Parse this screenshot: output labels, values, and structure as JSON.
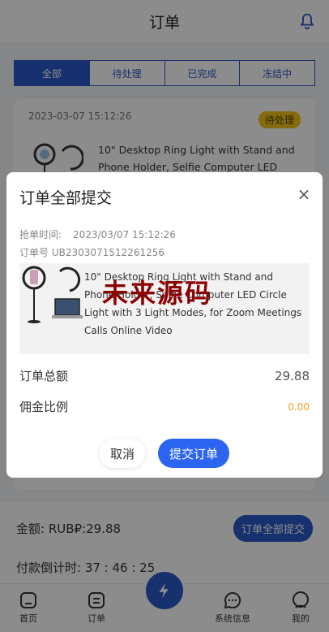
{
  "header": {
    "title": "订单"
  },
  "tabs": [
    {
      "label": "全部",
      "active": true
    },
    {
      "label": "待处理",
      "active": false
    },
    {
      "label": "已完成",
      "active": false
    },
    {
      "label": "冻结中",
      "active": false
    }
  ],
  "order_card": {
    "time": "2023-03-07 15:12:26",
    "status": "待处理",
    "title": "10\" Desktop Ring Light with Stand and Phone Holder, Selfie Computer LED Circle"
  },
  "bottom": {
    "amount": "金额:  RUB₽:29.88",
    "submit_all": "订单全部提交",
    "countdown": "付款倒计时:  37 : 46 : 25"
  },
  "tabbar": {
    "home": "首页",
    "orders": "订单",
    "messages": "系统信息",
    "mine": "我的"
  },
  "modal": {
    "title": "订单全部提交",
    "close": "×",
    "grab_time_label": "抢单时间:",
    "grab_time_value": "2023/03/07 15:12:26",
    "order_no": "订单号 UB2303071512261256",
    "product_text": "10\" Desktop Ring Light with Stand and Phone Holder, Selfie Computer LED Circle Light with 3 Light Modes, for Zoom Meetings Calls Online Video",
    "watermark": "未来源码",
    "total_label": "订单总额",
    "total_value": "29.88",
    "commission_label": "佣金比例",
    "commission_value": "0.00",
    "cancel": "取消",
    "submit": "提交订单"
  },
  "colors": {
    "primary": "#2b59c8",
    "submit": "#2b64f0",
    "badge": "#f0c419",
    "commission": "#f0a020",
    "watermark": "#8b0000"
  }
}
